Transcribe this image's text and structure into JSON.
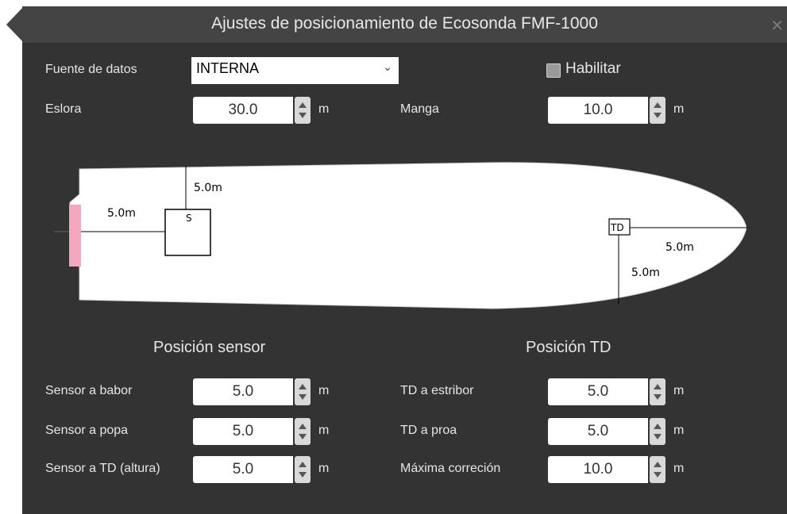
{
  "dialog": {
    "title": "Ajustes de posicionamiento de Ecosonda FMF-1000"
  },
  "top": {
    "source_label": "Fuente de datos",
    "source_value": "INTERNA",
    "enable_label": "Habilitar",
    "enable_checked": false,
    "length_label": "Eslora",
    "length_value": "30.0",
    "length_unit": "m",
    "beam_label": "Manga",
    "beam_value": "10.0",
    "beam_unit": "m"
  },
  "diagram": {
    "sensor_marker": "S",
    "td_marker": "TD",
    "sensor_up_label": "5.0m",
    "sensor_left_label": "5.0m",
    "td_right_label": "5.0m",
    "td_down_label": "5.0m",
    "hull_color": "#ffffff",
    "stern_marker_color": "#f4a8c0"
  },
  "sensor_section": {
    "title": "Posición sensor",
    "rows": [
      {
        "label": "Sensor a babor",
        "value": "5.0",
        "unit": "m"
      },
      {
        "label": "Sensor a popa",
        "value": "5.0",
        "unit": "m"
      },
      {
        "label": "Sensor a TD (altura)",
        "value": "5.0",
        "unit": "m"
      }
    ]
  },
  "td_section": {
    "title": "Posición TD",
    "rows": [
      {
        "label": "TD a estribor",
        "value": "5.0",
        "unit": "m"
      },
      {
        "label": "TD a proa",
        "value": "5.0",
        "unit": "m"
      },
      {
        "label": "Máxima correción",
        "value": "10.0",
        "unit": "m"
      }
    ]
  }
}
